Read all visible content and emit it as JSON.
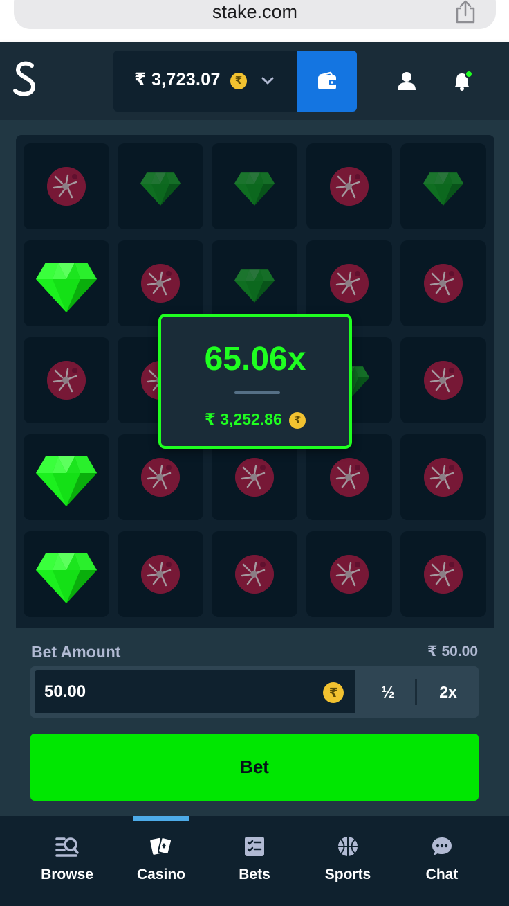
{
  "browser": {
    "url": "stake.com"
  },
  "header": {
    "balance": "₹ 3,723.07",
    "currency_symbol": "₹"
  },
  "grid": {
    "rows": [
      [
        "mine",
        "gem-dim",
        "gem-dim",
        "mine",
        "gem-dim"
      ],
      [
        "gem",
        "mine",
        "gem-dim",
        "mine",
        "mine"
      ],
      [
        "mine",
        "mine",
        "gem-dim",
        "gem-dim",
        "mine"
      ],
      [
        "gem",
        "mine",
        "mine",
        "mine",
        "mine"
      ],
      [
        "gem",
        "mine",
        "mine",
        "mine",
        "mine"
      ]
    ]
  },
  "result": {
    "multiplier": "65.06x",
    "payout": "₹ 3,252.86"
  },
  "bet": {
    "label": "Bet Amount",
    "value_label": "₹ 50.00",
    "amount": "50.00",
    "half_label": "½",
    "double_label": "2x",
    "button_label": "Bet"
  },
  "nav": {
    "items": [
      {
        "label": "Browse",
        "icon": "browse-icon"
      },
      {
        "label": "Casino",
        "icon": "casino-icon",
        "active": true
      },
      {
        "label": "Bets",
        "icon": "bets-icon"
      },
      {
        "label": "Sports",
        "icon": "sports-icon"
      },
      {
        "label": "Chat",
        "icon": "chat-icon"
      }
    ]
  },
  "colors": {
    "accent_green": "#1fff20",
    "bet_button": "#00e701",
    "wallet_blue": "#1475e1",
    "mine_red": "#8a1538"
  }
}
